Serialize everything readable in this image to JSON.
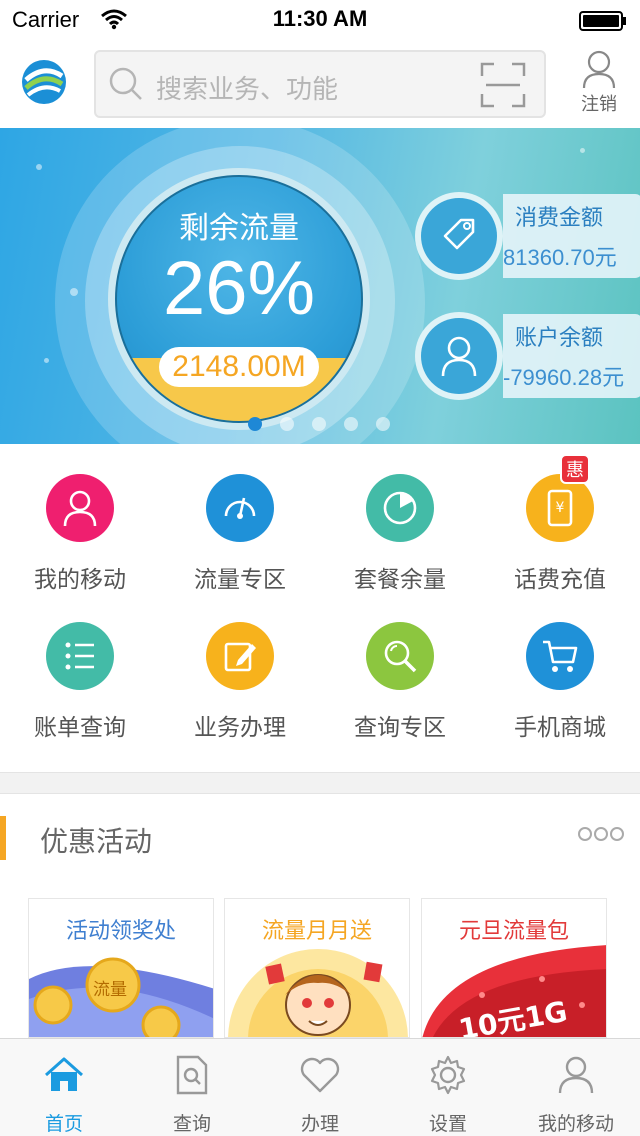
{
  "status_bar": {
    "carrier": "Carrier",
    "time": "11:30 AM"
  },
  "header": {
    "search_placeholder": "搜索业务、功能",
    "logout_label": "注销"
  },
  "banner": {
    "gauge_title": "剩余流量",
    "gauge_percent": "26%",
    "gauge_fill_fraction": 0.26,
    "gauge_amount": "2148.00M",
    "slide_count": 5,
    "active_slide": 1,
    "cards": [
      {
        "label": "消费金额",
        "value": "81360.70元",
        "icon": "tag-icon"
      },
      {
        "label": "账户余额",
        "value": "-79960.28元",
        "icon": "user-icon"
      }
    ]
  },
  "grid": [
    {
      "label": "我的移动",
      "icon": "user-icon",
      "color": "#ef1f6f"
    },
    {
      "label": "流量专区",
      "icon": "speedometer-icon",
      "color": "#1f91d8"
    },
    {
      "label": "套餐余量",
      "icon": "pie-timer-icon",
      "color": "#43bba7"
    },
    {
      "label": "话费充值",
      "icon": "phone-yuan-icon",
      "color": "#f7b21c",
      "badge": "惠"
    },
    {
      "label": "账单查询",
      "icon": "list-icon",
      "color": "#43bba7"
    },
    {
      "label": "业务办理",
      "icon": "edit-icon",
      "color": "#f7b21c"
    },
    {
      "label": "查询专区",
      "icon": "magnifier-icon",
      "color": "#8cc63f"
    },
    {
      "label": "手机商城",
      "icon": "cart-icon",
      "color": "#1f91d8"
    }
  ],
  "promotions": {
    "title": "优惠活动",
    "more_icon": "more-dots-icon",
    "cards": [
      {
        "title": "活动领奖处",
        "title_color": "#3f7fd0",
        "coin_text": "流量"
      },
      {
        "title": "流量月月送",
        "title_color": "#f5a623"
      },
      {
        "title": "元旦流量包",
        "title_color": "#e23a3a",
        "price_text": "10元1G"
      }
    ]
  },
  "tabbar": [
    {
      "label": "首页",
      "icon": "home-icon",
      "active": true
    },
    {
      "label": "查询",
      "icon": "search-doc-icon",
      "active": false
    },
    {
      "label": "办理",
      "icon": "heart-icon",
      "active": false
    },
    {
      "label": "设置",
      "icon": "gear-icon",
      "active": false
    },
    {
      "label": "我的移动",
      "icon": "user-icon",
      "active": false
    }
  ]
}
